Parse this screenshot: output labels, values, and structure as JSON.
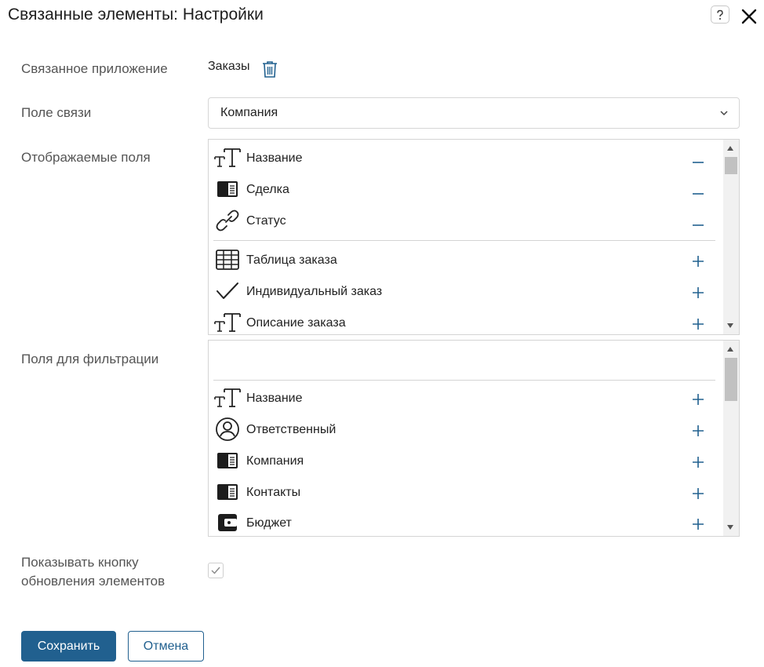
{
  "dialog": {
    "title": "Связанные элементы: Настройки",
    "help_label": "?",
    "close_icon": "close-icon"
  },
  "linked_app": {
    "label": "Связанное приложение",
    "value": "Заказы",
    "icon": "trash-icon"
  },
  "link_field": {
    "label": "Поле связи",
    "value": "Компания"
  },
  "display_fields": {
    "label": "Отображаемые поля",
    "selected": [
      {
        "name": "Название",
        "icon": "text-type-icon"
      },
      {
        "name": "Сделка",
        "icon": "app-link-icon"
      },
      {
        "name": "Статус",
        "icon": "link-icon"
      }
    ],
    "available": [
      {
        "name": "Таблица заказа",
        "icon": "table-icon"
      },
      {
        "name": "Индивидуальный заказ",
        "icon": "checkmark-icon"
      },
      {
        "name": "Описание заказа",
        "icon": "text-type-icon"
      }
    ]
  },
  "filter_fields": {
    "label": "Поля для фильтрации",
    "available": [
      {
        "name": "Название",
        "icon": "text-type-icon"
      },
      {
        "name": "Ответственный",
        "icon": "user-icon"
      },
      {
        "name": "Компания",
        "icon": "app-link-icon"
      },
      {
        "name": "Контакты",
        "icon": "app-link-icon"
      },
      {
        "name": "Бюджет",
        "icon": "wallet-icon"
      }
    ]
  },
  "refresh_option": {
    "label_line1": "Показывать кнопку",
    "label_line2": "обновления элементов",
    "checked": true
  },
  "buttons": {
    "save": "Сохранить",
    "cancel": "Отмена"
  },
  "colors": {
    "primary": "#21608f",
    "icon_blue": "#21608f"
  }
}
